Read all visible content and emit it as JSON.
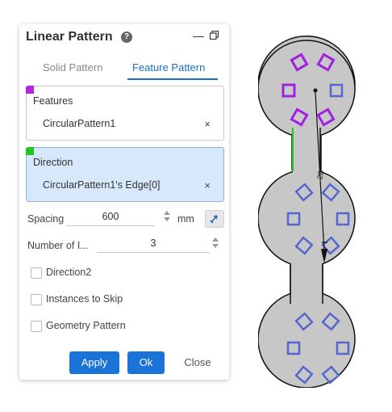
{
  "panel": {
    "title": "Linear Pattern",
    "help_icon": "?",
    "minimize": "—",
    "tabs": [
      {
        "label": "Solid Pattern",
        "active": false
      },
      {
        "label": "Feature Pattern",
        "active": true
      }
    ],
    "features": {
      "label": "Features",
      "value": "CircularPattern1",
      "close": "×",
      "corner_color": "#b027e0"
    },
    "direction": {
      "label": "Direction",
      "value": "CircularPattern1's Edge[0]",
      "close": "×",
      "corner_color": "#22c322"
    },
    "spacing": {
      "label": "Spacing",
      "value": "600",
      "unit": "mm"
    },
    "instances": {
      "label": "Number of I...",
      "value": "3"
    },
    "checkboxes": [
      {
        "label": "Direction2",
        "checked": false
      },
      {
        "label": "Instances to Skip",
        "checked": false
      },
      {
        "label": "Geometry Pattern",
        "checked": false
      }
    ],
    "buttons": {
      "apply": "Apply",
      "ok": "Ok",
      "close": "Close"
    }
  },
  "viewport": {
    "part_fill": "#c7c7c7",
    "selected_color": "#a020e0",
    "pattern_color": "#5566cc",
    "edge_color": "#22c322",
    "arrow_label": "2D"
  }
}
